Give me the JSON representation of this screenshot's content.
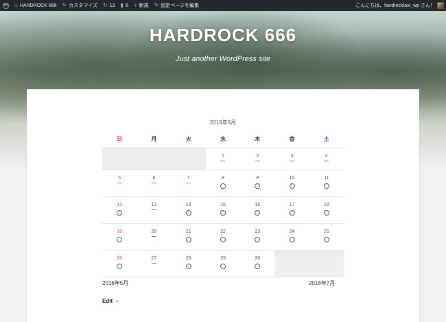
{
  "adminbar": {
    "site_name": "HARDROCK 666",
    "customize": "カスタマイズ",
    "updates_count": "13",
    "comments_count": "6",
    "new_label": "新規",
    "edit_page": "固定ページを編集",
    "greeting": "こんにちは、hardrocktaxi_wp さん！"
  },
  "header": {
    "title": "HARDROCK 666",
    "tagline": "Just another WordPress site"
  },
  "calendar": {
    "caption": "2016年6月",
    "weekdays": [
      "日",
      "月",
      "火",
      "水",
      "木",
      "金",
      "土"
    ],
    "rows": [
      [
        null,
        null,
        null,
        {
          "day": "1",
          "mark": "dash"
        },
        {
          "day": "2",
          "mark": "dash"
        },
        {
          "day": "3",
          "mark": "dash"
        },
        {
          "day": "4",
          "mark": "dash"
        }
      ],
      [
        {
          "day": "5",
          "mark": "dash"
        },
        {
          "day": "6",
          "mark": "dash"
        },
        {
          "day": "7",
          "mark": "dash"
        },
        {
          "day": "8",
          "mark": "circle"
        },
        {
          "day": "9",
          "mark": "circle"
        },
        {
          "day": "10",
          "mark": "circle"
        },
        {
          "day": "11",
          "mark": "circle"
        }
      ],
      [
        {
          "day": "12",
          "mark": "circle"
        },
        {
          "day": "13",
          "mark": "dash"
        },
        {
          "day": "14",
          "mark": "circle"
        },
        {
          "day": "15",
          "mark": "circle"
        },
        {
          "day": "16",
          "mark": "circle"
        },
        {
          "day": "17",
          "mark": "circle"
        },
        {
          "day": "18",
          "mark": "circle"
        }
      ],
      [
        {
          "day": "19",
          "mark": "circle"
        },
        {
          "day": "20",
          "mark": "dash"
        },
        {
          "day": "21",
          "mark": "circle"
        },
        {
          "day": "22",
          "mark": "circle"
        },
        {
          "day": "23",
          "mark": "circle"
        },
        {
          "day": "24",
          "mark": "circle"
        },
        {
          "day": "25",
          "mark": "circle"
        }
      ],
      [
        {
          "day": "26",
          "mark": "circle"
        },
        {
          "day": "27",
          "mark": "dash"
        },
        {
          "day": "28",
          "mark": "circle"
        },
        {
          "day": "29",
          "mark": "circle"
        },
        {
          "day": "30",
          "mark": "circle"
        },
        null,
        null
      ]
    ],
    "prev_month": "2016年5月",
    "next_month": "2016年7月"
  },
  "edit_link": "Edit →",
  "colors": {
    "adminbar_bg": "#23282d",
    "sunday": "#e03030",
    "saturday": "#3344cc",
    "empty_cell": "#eeeeee"
  }
}
